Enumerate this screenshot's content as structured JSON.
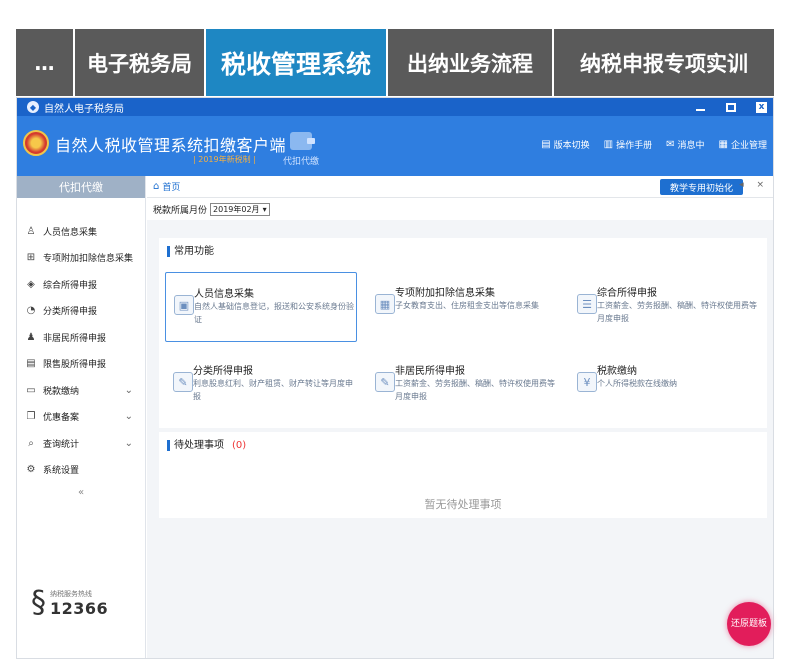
{
  "top_tabs": [
    {
      "label": "…",
      "active": false
    },
    {
      "label": "电子税务局",
      "active": false
    },
    {
      "label": "税收管理系统",
      "active": true
    },
    {
      "label": "出纳业务流程",
      "active": false
    },
    {
      "label": "纳税申报专项实训",
      "active": false
    }
  ],
  "window": {
    "title": "自然人电子税务局",
    "close_glyph": "x"
  },
  "header": {
    "title": "自然人税收管理系统扣缴客户端",
    "subtitle": "| 2019年新税制 |",
    "withhold_label": "代扣代缴",
    "links": [
      {
        "label": "版本切换",
        "icon": "version-icon"
      },
      {
        "label": "操作手册",
        "icon": "manual-icon"
      },
      {
        "label": "消息中",
        "icon": "mail-icon"
      },
      {
        "label": "企业管理",
        "icon": "company-icon"
      }
    ]
  },
  "sidebar": {
    "heading": "代扣代缴",
    "items": [
      {
        "label": "人员信息采集",
        "icon": "person-icon",
        "expand": false
      },
      {
        "label": "专项附加扣除信息采集",
        "icon": "grid-icon",
        "expand": false
      },
      {
        "label": "综合所得申报",
        "icon": "layers-icon",
        "expand": false
      },
      {
        "label": "分类所得申报",
        "icon": "pie-icon",
        "expand": false
      },
      {
        "label": "非居民所得申报",
        "icon": "user-icon",
        "expand": false
      },
      {
        "label": "限售股所得申报",
        "icon": "doc-icon",
        "expand": false
      },
      {
        "label": "税款缴纳",
        "icon": "folder-icon",
        "expand": true
      },
      {
        "label": "优惠备案",
        "icon": "copy-icon",
        "expand": true
      },
      {
        "label": "查询统计",
        "icon": "search-doc-icon",
        "expand": true
      },
      {
        "label": "系统设置",
        "icon": "gear-icon",
        "expand": false
      }
    ],
    "collapse_glyph": "«",
    "hotline_label": "纳税服务热线",
    "hotline_number": "12366"
  },
  "main": {
    "breadcrumb": "首页",
    "init_button": "教学专用初始化",
    "tab_controls": "◂ ×",
    "month_label": "税款所属月份",
    "month_value": "2019年02月",
    "common_title": "常用功能",
    "functions": [
      {
        "name": "人员信息采集",
        "desc": "自然人基础信息登记，报送和公安系统身份验证"
      },
      {
        "name": "专项附加扣除信息采集",
        "desc": "子女教育支出、住房租金支出等信息采集"
      },
      {
        "name": "综合所得申报",
        "desc": "工资薪金、劳务报酬、稿酬、特许权使用费等月度申报"
      },
      {
        "name": "分类所得申报",
        "desc": "利息股息红利、财产租赁、财产转让等月度申报"
      },
      {
        "name": "非居民所得申报",
        "desc": "工资薪金、劳务报酬、稿酬、特许权使用费等月度申报"
      },
      {
        "name": "税款缴纳",
        "desc": "个人所得税款在线缴纳"
      }
    ],
    "todo_title": "待处理事项",
    "todo_count": "(0)",
    "todo_empty": "暂无待处理事项"
  },
  "restore_button": "还原题板"
}
